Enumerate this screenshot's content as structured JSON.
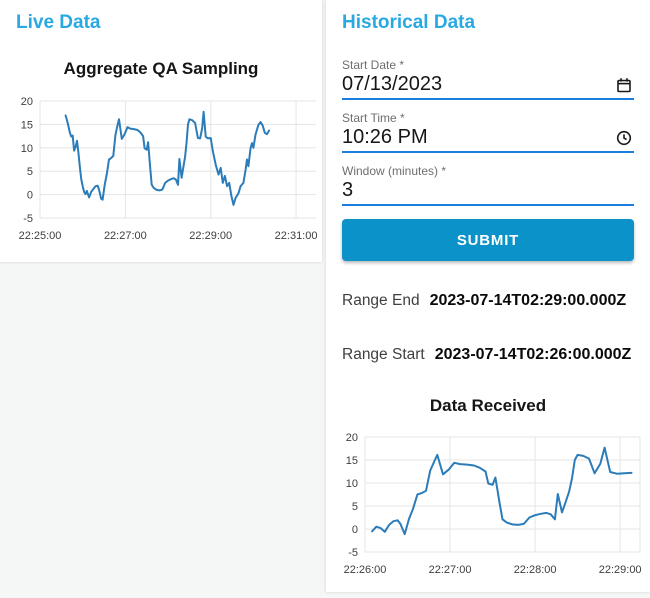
{
  "theme": {
    "page_bg": "#f5f6f6",
    "card_bg": "#ffffff",
    "header_blue": "#29a9e1",
    "underline_blue": "#1b7fd9",
    "label_gray": "#6e6e6e",
    "value_color": "#161616",
    "button_blue": "#0b93c9",
    "button_text": "#ffffff",
    "range_label_color": "#3f3f3f",
    "range_value_color": "#0a0a0a",
    "grid_color": "#e5e5e5",
    "tick_color": "#3e3e3e",
    "line_color": "#2b7cb9"
  },
  "live_panel": {
    "title": "Live Data"
  },
  "historical_panel": {
    "title": "Historical Data",
    "fields": [
      {
        "label": "Start Date *",
        "value": "07/13/2023",
        "icon": "calendar-icon"
      },
      {
        "label": "Start Time *",
        "value": "10:26 PM",
        "icon": "clock-icon"
      },
      {
        "label": "Window (minutes) *",
        "value": "3",
        "icon": "none"
      }
    ],
    "submit_label": "SUBMIT",
    "range_end": {
      "label": "Range End",
      "value": "2023-07-14T02:29:00.000Z"
    },
    "range_start": {
      "label": "Range Start",
      "value": "2023-07-14T02:26:00.000Z"
    }
  },
  "chart_data": [
    {
      "type": "line",
      "title": "Aggregate QA Sampling",
      "xlabel": "",
      "ylabel": "",
      "x_tick_labels": [
        "22:25:00",
        "22:27:00",
        "22:29:00",
        "22:31:00"
      ],
      "x_tick_seconds": [
        0,
        120,
        240,
        360
      ],
      "xlim": [
        0,
        388
      ],
      "y_ticks": [
        20,
        15,
        10,
        5,
        0,
        -5
      ],
      "ylim": [
        -5,
        20
      ],
      "grid": true,
      "legend": false,
      "right_border": false,
      "line_color": "#2b7cb9",
      "grid_color": "#e5e5e5",
      "points": [
        [
          36,
          16.9
        ],
        [
          38,
          15.9
        ],
        [
          40,
          14.6
        ],
        [
          42,
          13.2
        ],
        [
          44,
          12.4
        ],
        [
          46,
          12.6
        ],
        [
          48,
          9.4
        ],
        [
          50,
          10.2
        ],
        [
          52,
          11.5
        ],
        [
          54,
          9.0
        ],
        [
          56,
          6.0
        ],
        [
          58,
          3.2
        ],
        [
          60,
          1.8
        ],
        [
          62,
          0.6
        ],
        [
          64,
          0.1
        ],
        [
          66,
          0.8
        ],
        [
          69,
          -0.6
        ],
        [
          72,
          0.6
        ],
        [
          75,
          1.2
        ],
        [
          78,
          1.8
        ],
        [
          81,
          1.9
        ],
        [
          83,
          1.1
        ],
        [
          86,
          -0.9
        ],
        [
          88,
          -1.1
        ],
        [
          91,
          2.1
        ],
        [
          94,
          4.5
        ],
        [
          97,
          7.5
        ],
        [
          100,
          7.8
        ],
        [
          103,
          8.3
        ],
        [
          106,
          12.7
        ],
        [
          109,
          14.8
        ],
        [
          111,
          16.1
        ],
        [
          115,
          11.9
        ],
        [
          119,
          12.9
        ],
        [
          123,
          14.4
        ],
        [
          127,
          14.1
        ],
        [
          132,
          14.0
        ],
        [
          137,
          13.8
        ],
        [
          141,
          13.3
        ],
        [
          145,
          12.5
        ],
        [
          147,
          9.9
        ],
        [
          150,
          9.6
        ],
        [
          152,
          11.2
        ],
        [
          155,
          5.5
        ],
        [
          157,
          2.1
        ],
        [
          160,
          1.4
        ],
        [
          164,
          1.0
        ],
        [
          168,
          0.9
        ],
        [
          172,
          1.1
        ],
        [
          176,
          2.5
        ],
        [
          180,
          3.0
        ],
        [
          184,
          3.3
        ],
        [
          188,
          3.5
        ],
        [
          191,
          3.2
        ],
        [
          194,
          2.1
        ],
        [
          196,
          7.6
        ],
        [
          199,
          3.6
        ],
        [
          201,
          5.4
        ],
        [
          204,
          8.1
        ],
        [
          206,
          11.0
        ],
        [
          208,
          15.0
        ],
        [
          210,
          16.1
        ],
        [
          214,
          15.9
        ],
        [
          218,
          15.3
        ],
        [
          222,
          12.1
        ],
        [
          225,
          12.0
        ],
        [
          228,
          14.2
        ],
        [
          230,
          17.7
        ],
        [
          233,
          12.4
        ],
        [
          236,
          12.0
        ],
        [
          240,
          12.1
        ],
        [
          243,
          9.2
        ],
        [
          247,
          6.4
        ],
        [
          251,
          4.3
        ],
        [
          254,
          5.7
        ],
        [
          257,
          2.5
        ],
        [
          260,
          4.0
        ],
        [
          263,
          1.8
        ],
        [
          266,
          2.5
        ],
        [
          269,
          -0.3
        ],
        [
          272,
          -2.2
        ],
        [
          275,
          -0.7
        ],
        [
          279,
          0.3
        ],
        [
          282,
          1.8
        ],
        [
          286,
          2.5
        ],
        [
          289,
          5.3
        ],
        [
          291,
          7.5
        ],
        [
          293,
          6.1
        ],
        [
          296,
          10.0
        ],
        [
          298,
          11.0
        ],
        [
          300,
          10.0
        ],
        [
          303,
          12.8
        ],
        [
          307,
          14.9
        ],
        [
          310,
          15.5
        ],
        [
          313,
          14.8
        ],
        [
          316,
          13.2
        ],
        [
          319,
          12.9
        ],
        [
          322,
          13.7
        ]
      ]
    },
    {
      "type": "line",
      "title": "Data Received",
      "xlabel": "",
      "ylabel": "",
      "x_tick_labels": [
        "22:26:00",
        "22:27:00",
        "22:28:00",
        "22:29:00"
      ],
      "x_tick_seconds": [
        0,
        60,
        120,
        180
      ],
      "xlim": [
        0,
        194
      ],
      "y_ticks": [
        20,
        15,
        10,
        5,
        0,
        -5
      ],
      "ylim": [
        -5,
        20
      ],
      "grid": true,
      "legend": false,
      "right_border": true,
      "line_color": "#2b7cb9",
      "grid_color": "#e5e5e5",
      "points": [
        [
          5,
          -0.5
        ],
        [
          8,
          0.5
        ],
        [
          11,
          0.2
        ],
        [
          14,
          -0.6
        ],
        [
          17,
          0.9
        ],
        [
          20,
          1.7
        ],
        [
          23,
          1.9
        ],
        [
          25,
          1.1
        ],
        [
          28,
          -1.1
        ],
        [
          31,
          2.1
        ],
        [
          34,
          4.5
        ],
        [
          37,
          7.5
        ],
        [
          40,
          7.8
        ],
        [
          43,
          8.3
        ],
        [
          46,
          12.7
        ],
        [
          49,
          14.8
        ],
        [
          51,
          16.1
        ],
        [
          55,
          11.9
        ],
        [
          59,
          12.9
        ],
        [
          63,
          14.4
        ],
        [
          67,
          14.1
        ],
        [
          72,
          14.0
        ],
        [
          77,
          13.8
        ],
        [
          81,
          13.3
        ],
        [
          85,
          12.5
        ],
        [
          87,
          9.9
        ],
        [
          90,
          9.6
        ],
        [
          92,
          11.2
        ],
        [
          95,
          5.5
        ],
        [
          97,
          2.1
        ],
        [
          100,
          1.4
        ],
        [
          104,
          1.0
        ],
        [
          108,
          0.9
        ],
        [
          112,
          1.1
        ],
        [
          116,
          2.5
        ],
        [
          120,
          3.0
        ],
        [
          124,
          3.3
        ],
        [
          128,
          3.5
        ],
        [
          131,
          3.2
        ],
        [
          134,
          2.1
        ],
        [
          136,
          7.6
        ],
        [
          139,
          3.6
        ],
        [
          141,
          5.4
        ],
        [
          144,
          8.1
        ],
        [
          146,
          11.0
        ],
        [
          148,
          15.0
        ],
        [
          150,
          16.1
        ],
        [
          154,
          15.9
        ],
        [
          158,
          15.3
        ],
        [
          162,
          12.1
        ],
        [
          166,
          14.2
        ],
        [
          169,
          17.7
        ],
        [
          173,
          12.4
        ],
        [
          178,
          12.0
        ],
        [
          183,
          12.1
        ],
        [
          188,
          12.2
        ]
      ]
    }
  ]
}
